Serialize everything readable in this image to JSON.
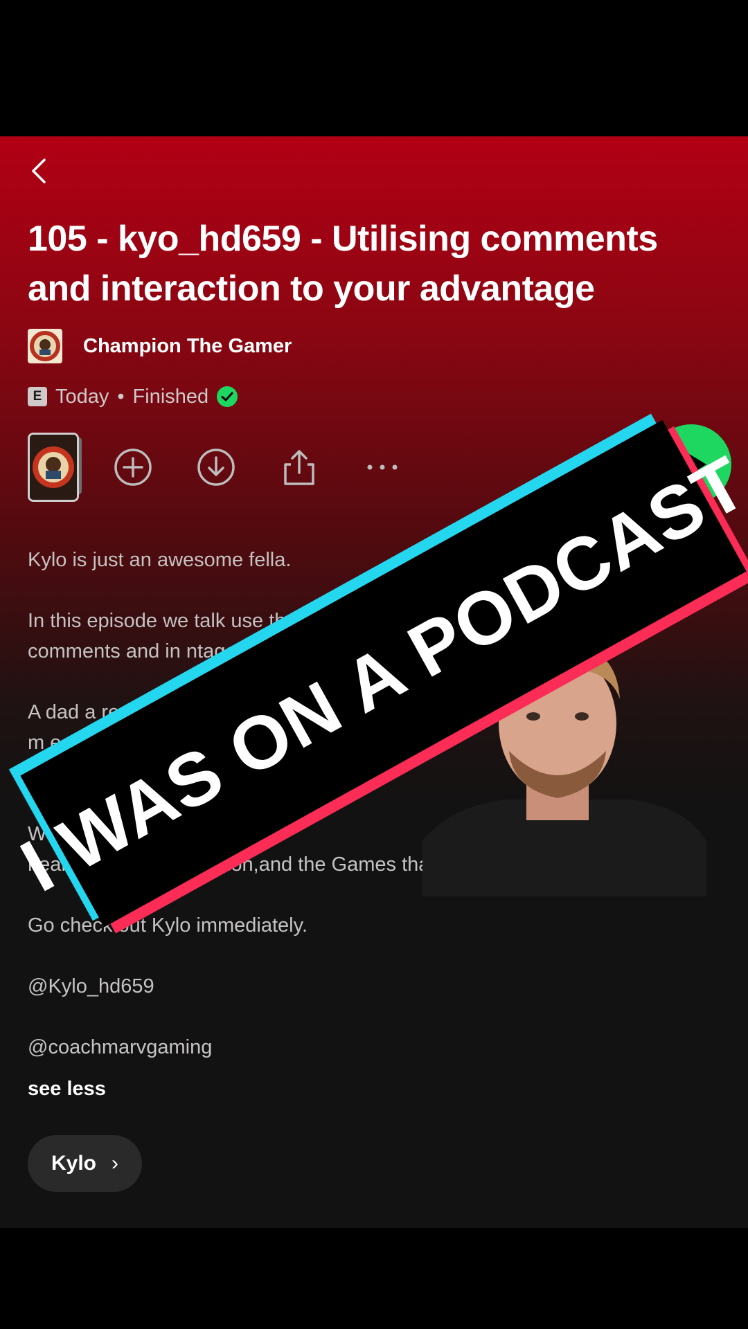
{
  "episode": {
    "title": "105 - kyo_hd659 - Utilising comments and interaction to your advantage",
    "show_name": "Champion The Gamer",
    "explicit_badge": "E",
    "date": "Today",
    "separator": "•",
    "status": "Finished"
  },
  "description": {
    "p1": "Kylo is just an awesome fella.",
    "p2": "In this episode we talk  use the\ncomments and in  ntage.",
    "p3": "A dad a  reak  he\nm  e presen  v he\nb",
    "p4": "We  rd out about, o  a\nhealth  to content creation,and the Games that  n.",
    "p5": "Go check out Kylo immediately.",
    "p6": "@Kylo_hd659",
    "p7": "@coachmarvgaming",
    "see_less": "see less"
  },
  "chip": {
    "label": "Kylo",
    "chevron": "›"
  },
  "overlay": {
    "banner_text": "I WAS ON A PODCAST"
  },
  "icons": {
    "back": "chevron-left-icon",
    "add": "plus-circle-icon",
    "download": "download-icon",
    "share": "share-icon",
    "more": "more-icon",
    "play": "play-icon",
    "finished": "check-circle-icon"
  },
  "colors": {
    "accent_green": "#1ed760",
    "header_red": "#b20014",
    "background": "#121212",
    "banner_cyan": "#25d6ef",
    "banner_red": "#fb2c55"
  }
}
